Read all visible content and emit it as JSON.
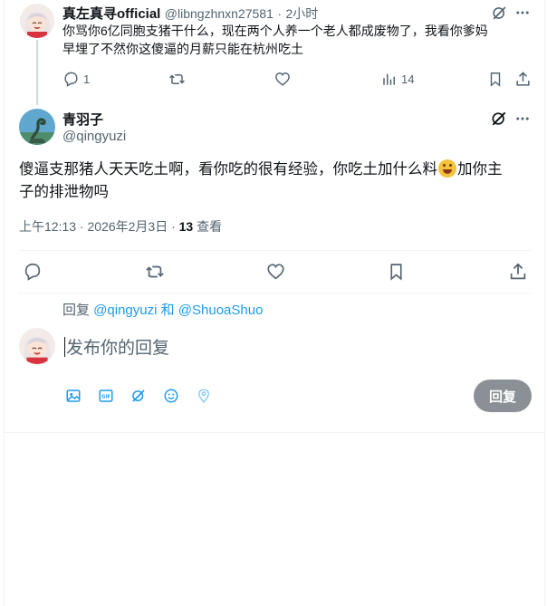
{
  "parent_tweet": {
    "display_name": "真左真寻official",
    "handle": "@libngzhnxn27581",
    "separator": "·",
    "time": "2小时",
    "text_line1": "你骂你6亿同胞支猪干什么，现在两个人养一个老人都成废物了，我看你爹妈",
    "text_line2": "早埋了不然你这傻逼的月薪只能在杭州吃土",
    "reply_count": "1",
    "view_count": "14"
  },
  "main_tweet": {
    "display_name": "青羽子",
    "handle": "@qingyuzi",
    "text_part1": "傻逼支那猪人天天吃土啊，看你吃的很有经验，你吃土加什么料",
    "text_part2": "加你主",
    "text_line2": "子的排泄物吗",
    "timestamp": "上午12:13 · 2026年2月3日 · ",
    "views_number": "13",
    "views_label": " 查看"
  },
  "reply_composer": {
    "replying_prefix": "回复 ",
    "mention1": "@qingyuzi",
    "conjunction": " 和 ",
    "mention2": "@ShuoaShuo",
    "placeholder": "发布你的回复",
    "reply_button_label": "回复"
  },
  "colors": {
    "accent": "#1d9bf0",
    "muted": "#536471",
    "disabled_button": "#8b9096"
  },
  "icons": [
    "grok-icon",
    "more-icon",
    "reply-icon",
    "retweet-icon",
    "like-icon",
    "views-icon",
    "bookmark-icon",
    "share-icon",
    "image-icon",
    "gif-icon",
    "emoji-icon",
    "location-icon"
  ]
}
